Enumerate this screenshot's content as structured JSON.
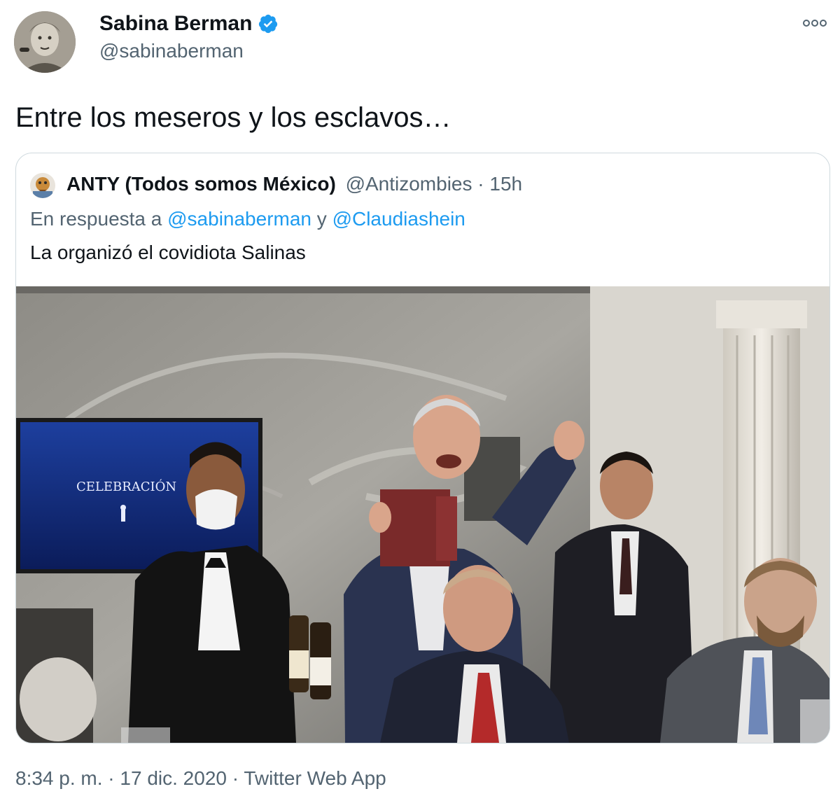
{
  "author": {
    "name": "Sabina Berman",
    "handle": "@sabinaberman",
    "verified": true
  },
  "tweet": {
    "text": "Entre los meseros y los esclavos…"
  },
  "quote": {
    "name": "ANTY (Todos somos México)",
    "handle": "@Antizombies",
    "separator": "·",
    "time": "15h",
    "reply_prefix": "En respuesta a",
    "reply_mention_1": "@sabinaberman",
    "reply_join": "y",
    "reply_mention_2": "@Claudiashein",
    "text": "La organizó el covidiota Salinas",
    "media": {
      "screen_text": "CELEBRACIÓN"
    }
  },
  "footer": {
    "time": "8:34 p. m.",
    "separator_1": "·",
    "date": "17 dic. 2020",
    "separator_2": "·",
    "source": "Twitter Web App"
  },
  "colors": {
    "accent": "#1d9bf0",
    "secondary_text": "#536471",
    "border": "#cfd9de"
  },
  "icons": {
    "verified": "verified-badge-icon",
    "more": "more-options-icon"
  }
}
